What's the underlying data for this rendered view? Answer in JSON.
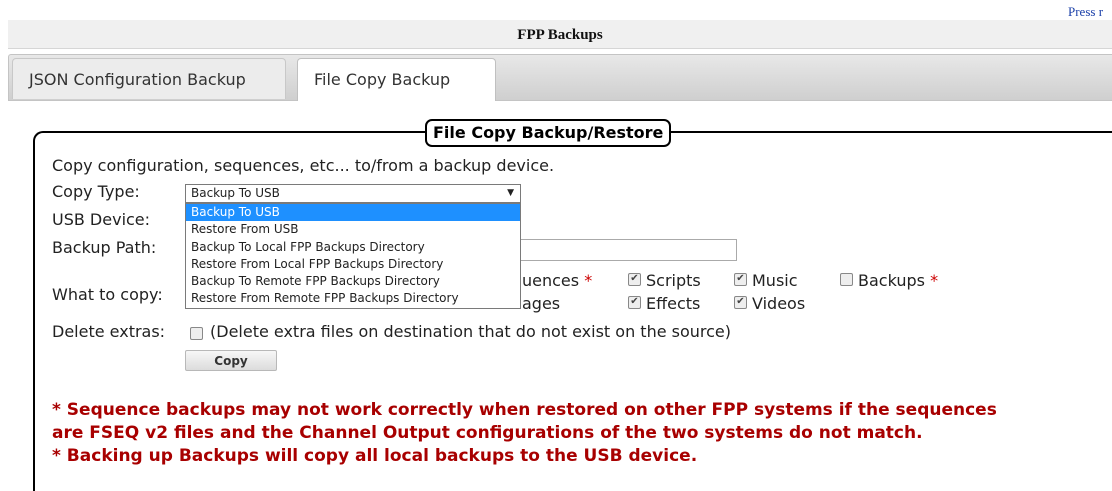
{
  "header": {
    "press_link": "Press r",
    "title": "FPP Backups"
  },
  "tabs": [
    {
      "label": "JSON Configuration Backup",
      "active": false
    },
    {
      "label": "File Copy Backup",
      "active": true
    }
  ],
  "panel": {
    "legend": "File Copy Backup/Restore",
    "description": "Copy configuration, sequences, etc... to/from a backup device.",
    "copy_type_label": "Copy Type:",
    "copy_type_selected": "Backup To USB",
    "copy_type_options": [
      "Backup To USB",
      "Restore From USB",
      "Backup To Local FPP Backups Directory",
      "Restore From Local FPP Backups Directory",
      "Backup To Remote FPP Backups Directory",
      "Restore From Remote FPP Backups Directory"
    ],
    "usb_device_label": "USB Device:",
    "backup_path_label": "Backup Path:",
    "backup_path_value": "",
    "what_to_copy_label": "What to copy:",
    "copy_items": [
      {
        "label": "uences",
        "checked": true,
        "star": "*"
      },
      {
        "label": "Scripts",
        "checked": true,
        "star": ""
      },
      {
        "label": "Music",
        "checked": true,
        "star": ""
      },
      {
        "label": "Backups",
        "checked": false,
        "star": "*"
      },
      {
        "label": "ages",
        "checked": true,
        "star": ""
      },
      {
        "label": "Effects",
        "checked": true,
        "star": ""
      },
      {
        "label": "Videos",
        "checked": true,
        "star": ""
      }
    ],
    "delete_extras_label": "Delete extras:",
    "delete_extras_note": "(Delete extra files on destination that do not exist on the source)",
    "copy_button": "Copy",
    "warnings": [
      "* Sequence backups may not work correctly when restored on other FPP systems if the sequences",
      "are FSEQ v2 files and the Channel Output configurations of the two systems do not match.",
      "* Backing up Backups will copy all local backups to the USB device."
    ]
  },
  "colors": {
    "accent_selected": "#1e90ff",
    "warning_text": "#a80000",
    "star": "#cc0000"
  }
}
